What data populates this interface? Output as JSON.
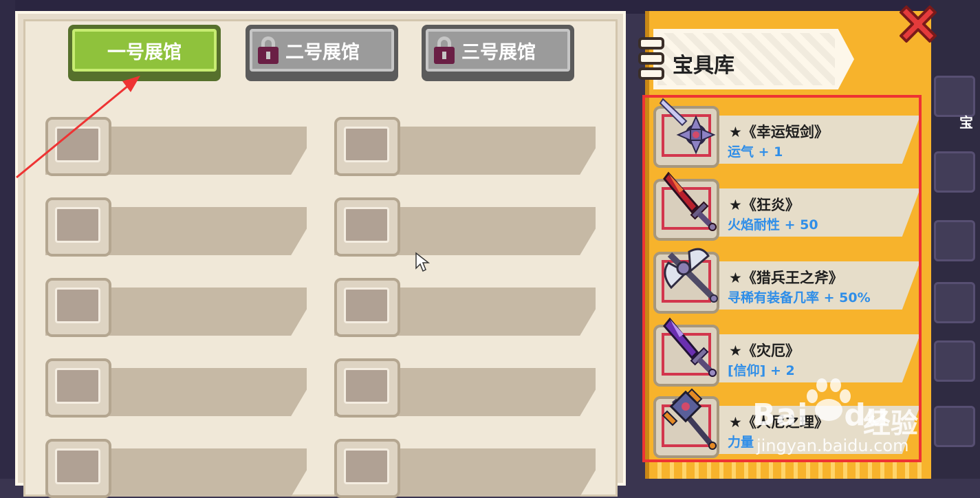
{
  "exhibit": {
    "tabs": [
      {
        "label": "一号展馆",
        "locked": false,
        "active": true
      },
      {
        "label": "二号展馆",
        "locked": true,
        "active": false
      },
      {
        "label": "三号展馆",
        "locked": true,
        "active": false
      }
    ]
  },
  "treasury": {
    "title": "宝具库",
    "items": [
      {
        "name": "★《幸运短剑》",
        "effect": "运气 + 1",
        "icon": "shuriken-dagger-icon"
      },
      {
        "name": "★《狂炎》",
        "effect": "火焰耐性 + 50",
        "icon": "flame-sword-icon"
      },
      {
        "name": "★《猎兵王之斧》",
        "effect": "寻稀有装备几率 + 50%",
        "icon": "battle-axe-icon"
      },
      {
        "name": "★《灾厄》",
        "effect": "[信仰] + 2",
        "icon": "purple-sword-icon"
      },
      {
        "name": "★《人尼之理》",
        "effect": "力量",
        "icon": "war-hammer-icon"
      }
    ]
  },
  "side": {
    "label": "宝"
  },
  "watermark": {
    "brand": "Bai",
    "brand2": "du",
    "cn": "经验",
    "url": "jingyan.baidu.com"
  },
  "colors": {
    "highlight": "#ee3333",
    "effect_text": "#2f8ee8",
    "active_tab": "#8fc23c"
  }
}
